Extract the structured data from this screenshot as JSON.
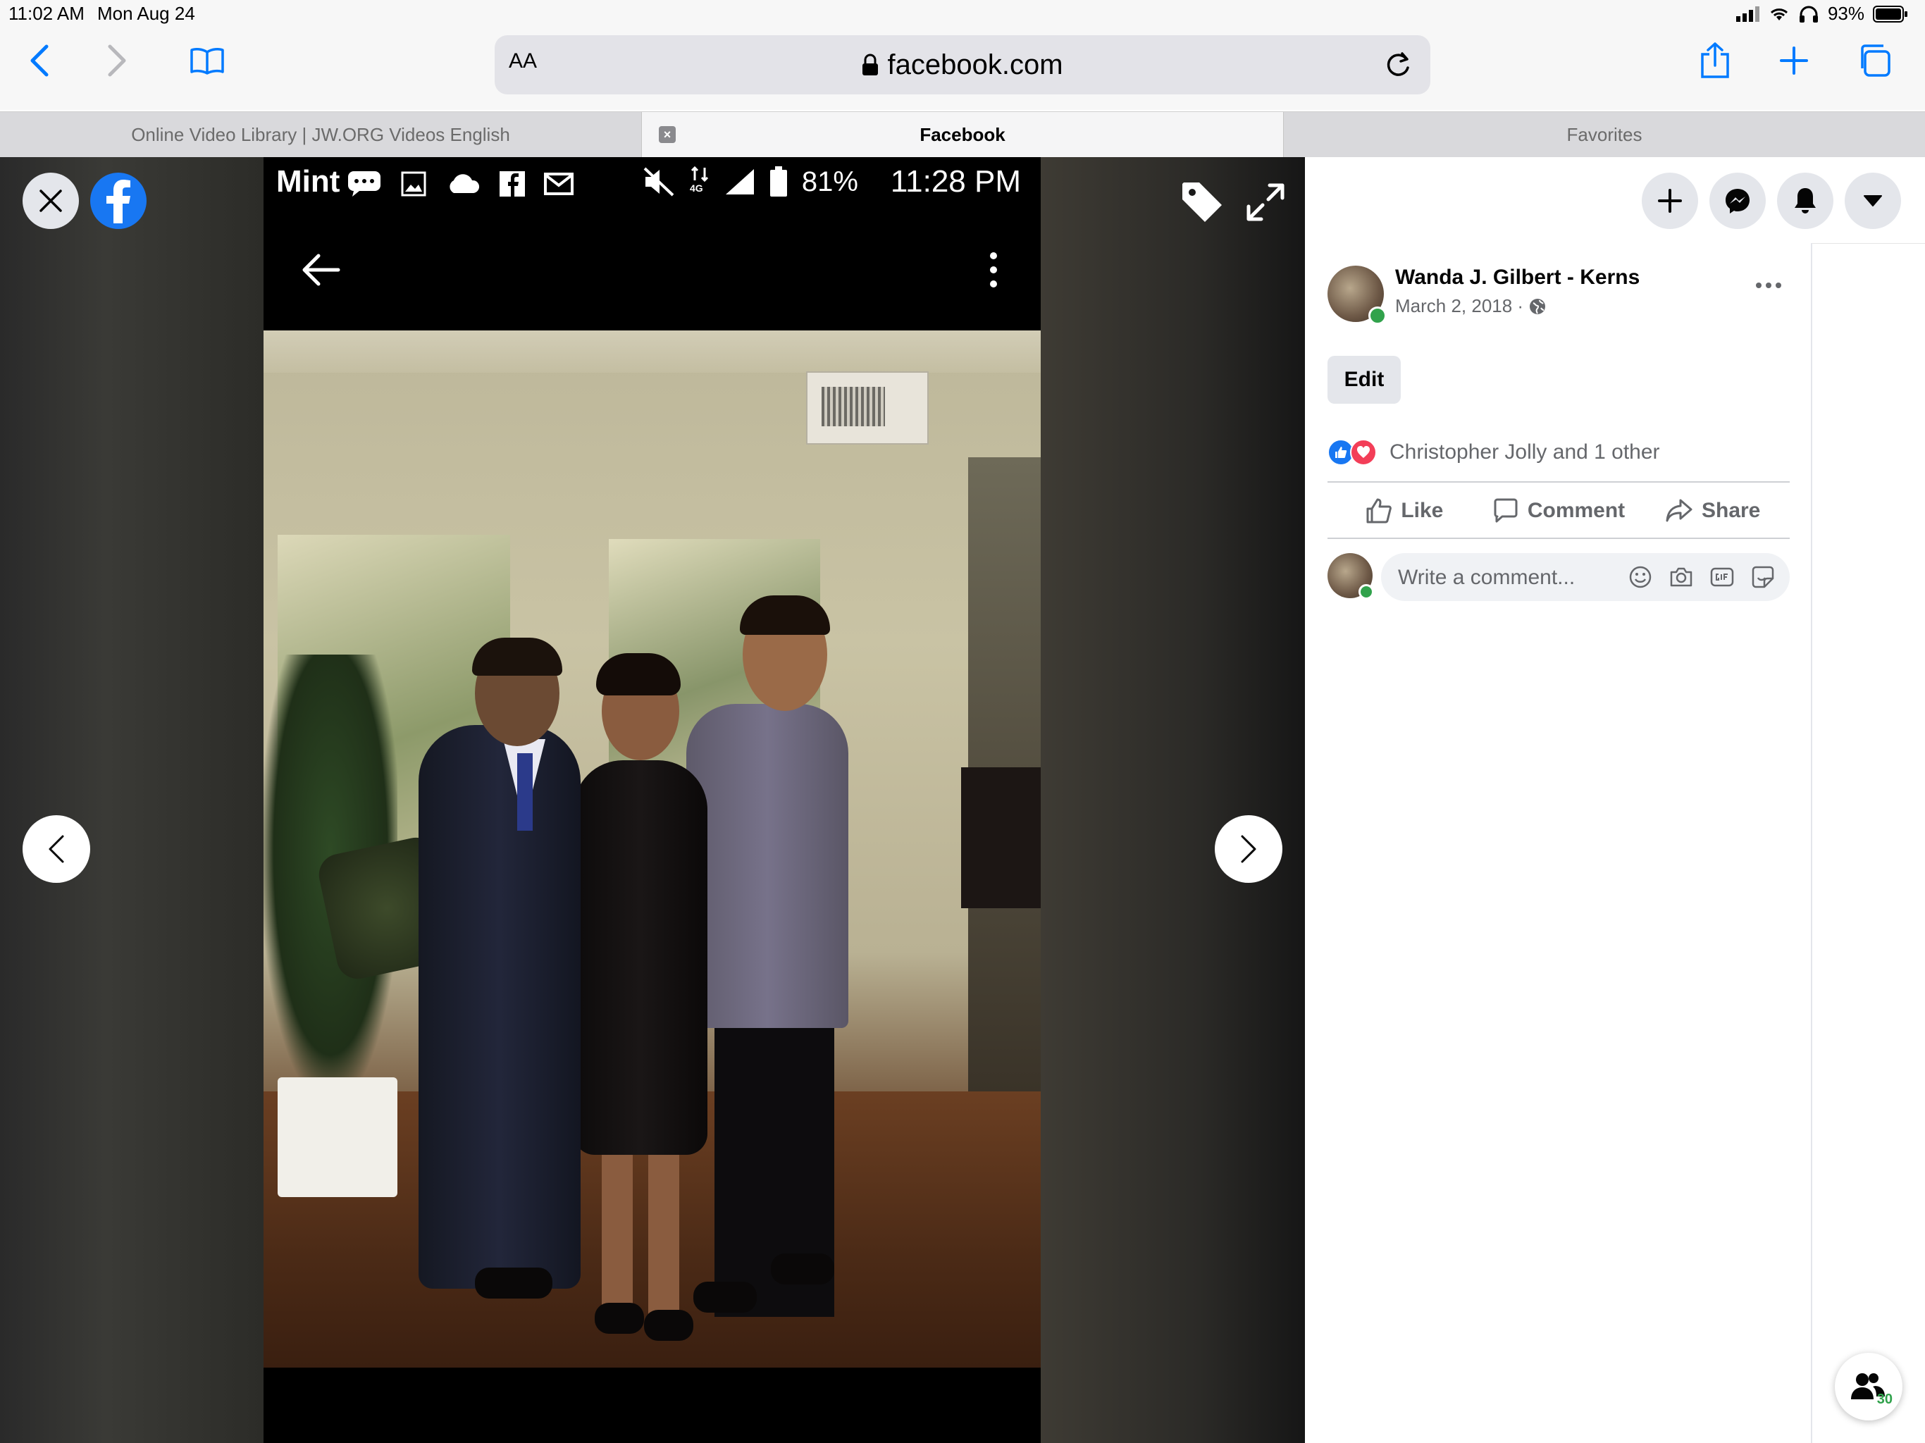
{
  "status_bar": {
    "time": "11:02 AM",
    "date": "Mon Aug 24",
    "battery": "93%"
  },
  "browser": {
    "aa_label": "AA",
    "url": "facebook.com",
    "tabs": [
      {
        "label": "Online Video Library | JW.ORG Videos English",
        "active": false
      },
      {
        "label": "Facebook",
        "active": true
      },
      {
        "label": "Favorites",
        "active": false
      }
    ],
    "tab_close_glyph": "×"
  },
  "photo_screenshot": {
    "carrier": "Mint",
    "battery": "81%",
    "time": "11:28 PM",
    "network": "4G"
  },
  "post": {
    "author": "Wanda J. Gilbert - Kerns",
    "date": "March 2, 2018 ·",
    "edit_label": "Edit",
    "reactions_text": "Christopher Jolly and 1 other",
    "actions": {
      "like": "Like",
      "comment": "Comment",
      "share": "Share"
    },
    "comment_placeholder": "Write a comment..."
  },
  "contacts": {
    "count": "30"
  },
  "colors": {
    "facebook_blue": "#1877f2",
    "safari_blue": "#007aff",
    "online_green": "#31a24c",
    "love_red": "#f33e58"
  }
}
